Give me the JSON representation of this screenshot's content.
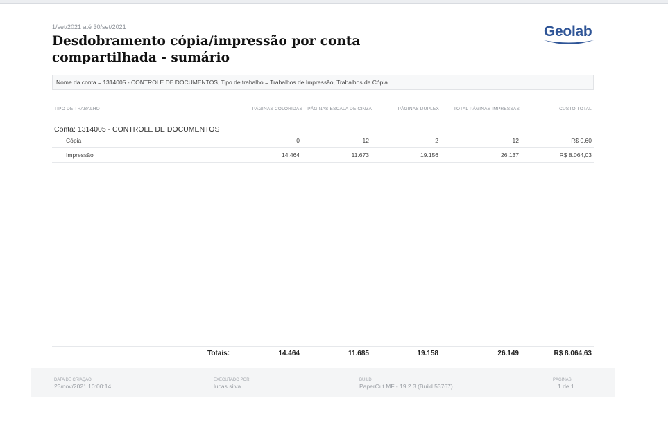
{
  "report": {
    "date_range": "1/set/2021 até 30/set/2021",
    "title": "Desdobramento cópia/impressão por conta compartilhada - sumário",
    "logo_text": "Geolab",
    "filter": "Nome da conta = 1314005 - CONTROLE DE DOCUMENTOS, Tipo de trabalho = Trabalhos de Impressão, Trabalhos de Cópia"
  },
  "table": {
    "headers": [
      "TIPO DE TRABALHO",
      "PÁGINAS COLORIDAS",
      "PÁGINAS ESCALA DE CINZA",
      "PÁGINAS DUPLEX",
      "TOTAL PÁGINAS IMPRESSAS",
      "CUSTO TOTAL"
    ],
    "account_label": "Conta: 1314005 - CONTROLE DE DOCUMENTOS",
    "rows": [
      [
        "Cópia",
        "0",
        "12",
        "2",
        "12",
        "R$ 0,60"
      ],
      [
        "Impressão",
        "14.464",
        "11.673",
        "19.156",
        "26.137",
        "R$ 8.064,03"
      ]
    ],
    "totals": [
      "Totais:",
      "14.464",
      "11.685",
      "19.158",
      "26.149",
      "R$ 8.064,63"
    ]
  },
  "footer": {
    "created_label": "DATA DE CRIAÇÃO",
    "created_value": "23/nov/2021 10:00:14",
    "executed_label": "EXECUTADO POR",
    "executed_value": "lucas.silva",
    "build_label": "BUILD",
    "build_value": "PaperCut MF - 19.2.3 (Build 53767)",
    "pages_label": "PÁGINAS",
    "pages_value": "1 de 1"
  },
  "colors": {
    "brand": "#2f5597",
    "title": "#111111",
    "muted": "#8a8f96"
  }
}
